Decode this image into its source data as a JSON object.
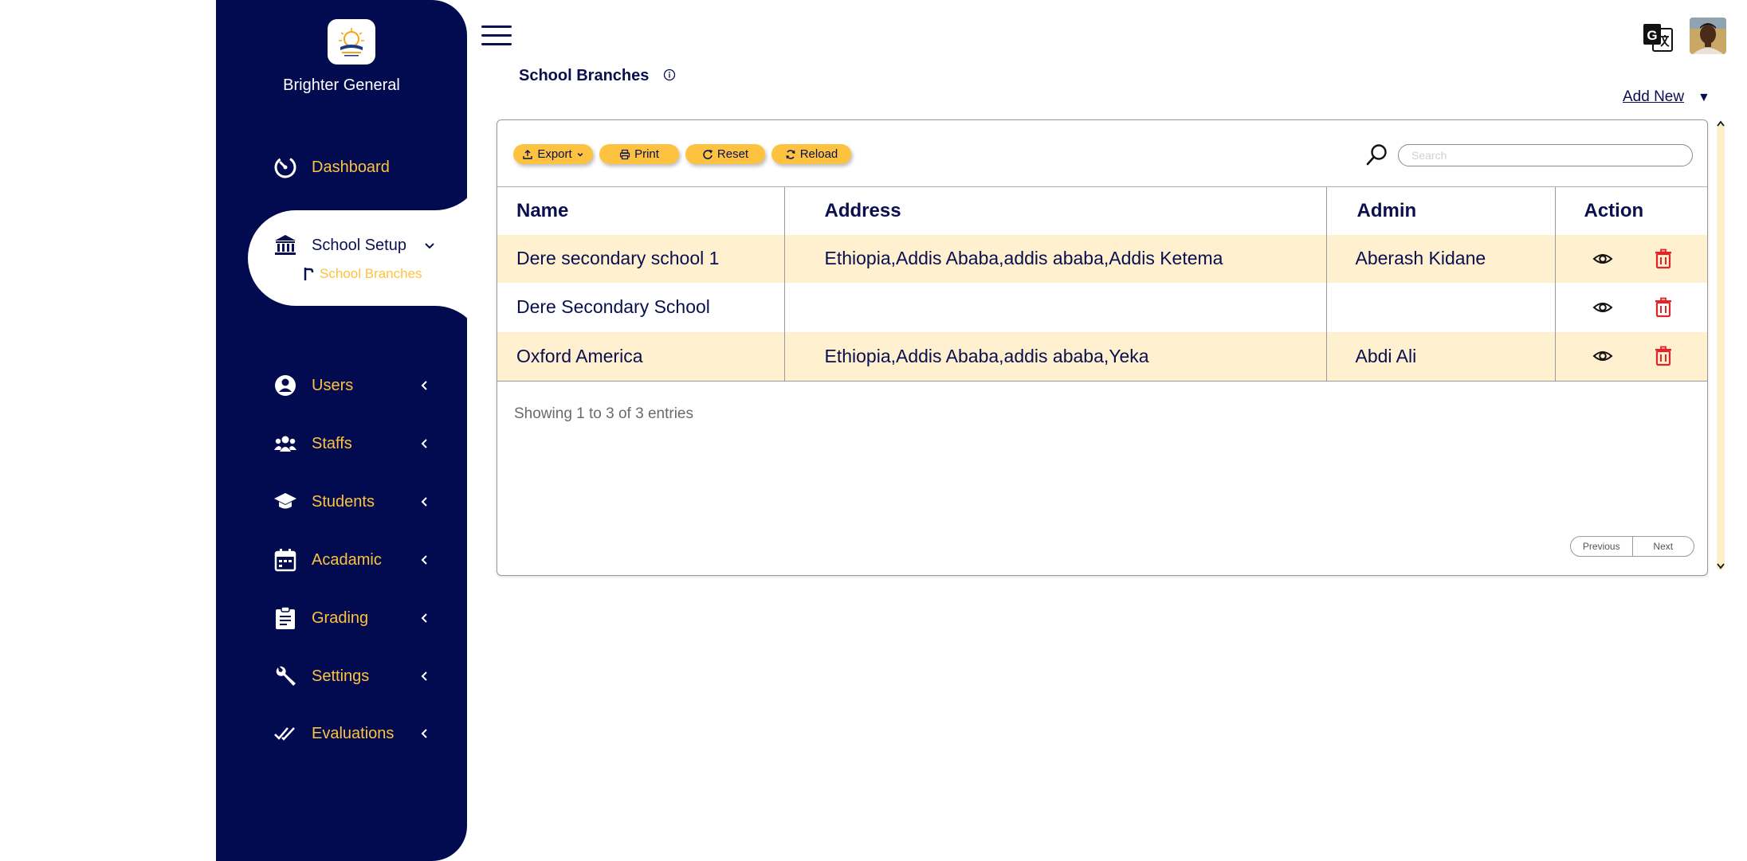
{
  "sidebar": {
    "org_name": "Brighter General",
    "items": {
      "dashboard": "Dashboard",
      "school_setup": "School Setup",
      "school_branches": "School Branches",
      "users": "Users",
      "staffs": "Staffs",
      "students": "Students",
      "academic": "Acadamic",
      "grading": "Grading",
      "settings": "Settings",
      "evaluations": "Evaluations"
    }
  },
  "header": {
    "title": "School Branches",
    "add_new": "Add New"
  },
  "toolbar": {
    "export": "Export",
    "print": "Print",
    "reset": "Reset",
    "reload": "Reload",
    "search_placeholder": "Search"
  },
  "table": {
    "columns": [
      "Name",
      "Address",
      "Admin",
      "Action"
    ],
    "rows": [
      {
        "name": "Dere secondary school 1",
        "address": "Ethiopia,Addis Ababa,addis ababa,Addis Ketema",
        "admin": "Aberash Kidane"
      },
      {
        "name": "Dere Secondary School",
        "address": "",
        "admin": ""
      },
      {
        "name": "Oxford America",
        "address": "Ethiopia,Addis Ababa,addis ababa,Yeka",
        "admin": "Abdi Ali"
      }
    ]
  },
  "footer": {
    "showing": "Showing 1 to 3 of 3 entries",
    "previous": "Previous",
    "next": "Next"
  },
  "colors": {
    "sidebar_bg": "#030b50",
    "accent": "#fdc23f",
    "row_highlight": "#fff1cf",
    "delete": "#e0242a"
  }
}
